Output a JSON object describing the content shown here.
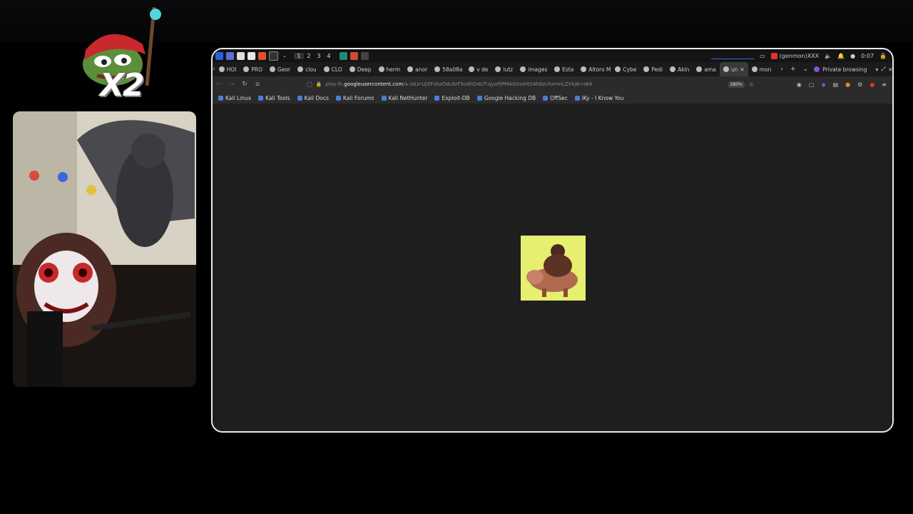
{
  "browser": {
    "workspaces": [
      "1",
      "2",
      "3",
      "4"
    ],
    "tray": {
      "genmon": "(genmon)XXX",
      "clock": "0:07"
    },
    "tabs": [
      {
        "label": "HOI"
      },
      {
        "label": "PRO"
      },
      {
        "label": "Geor"
      },
      {
        "label": "clou"
      },
      {
        "label": "CLO"
      },
      {
        "label": "Deep"
      },
      {
        "label": "herm"
      },
      {
        "label": "anor"
      },
      {
        "label": "58a08a"
      },
      {
        "label": "v de"
      },
      {
        "label": "lutz"
      },
      {
        "label": "images"
      },
      {
        "label": "Esta"
      },
      {
        "label": "Altoro M"
      },
      {
        "label": "Cybe"
      },
      {
        "label": "Pedi"
      },
      {
        "label": "Akin"
      },
      {
        "label": "ama"
      },
      {
        "label": "un"
      },
      {
        "label": "mon"
      }
    ],
    "private_label": "Private browsing",
    "url_prefix": "play-lh.",
    "url_domain": "googleusercontent.com",
    "url_path": "/a-/ALV-UjXFvbzOdu0rF5odhD4UT-qyaPJPMAGVvIHtS4h6zchxmnLZVkj8=s64",
    "zoom": "280%",
    "bookmarks": [
      {
        "label": "Kali Linux"
      },
      {
        "label": "Kali Tools"
      },
      {
        "label": "Kali Docs"
      },
      {
        "label": "Kali Forums"
      },
      {
        "label": "Kali NetHunter"
      },
      {
        "label": "Exploit-DB"
      },
      {
        "label": "Google Hacking DB"
      },
      {
        "label": "OffSec"
      },
      {
        "label": "iKy - I Know You"
      }
    ]
  },
  "overlay": {
    "badge_text": "X2"
  }
}
